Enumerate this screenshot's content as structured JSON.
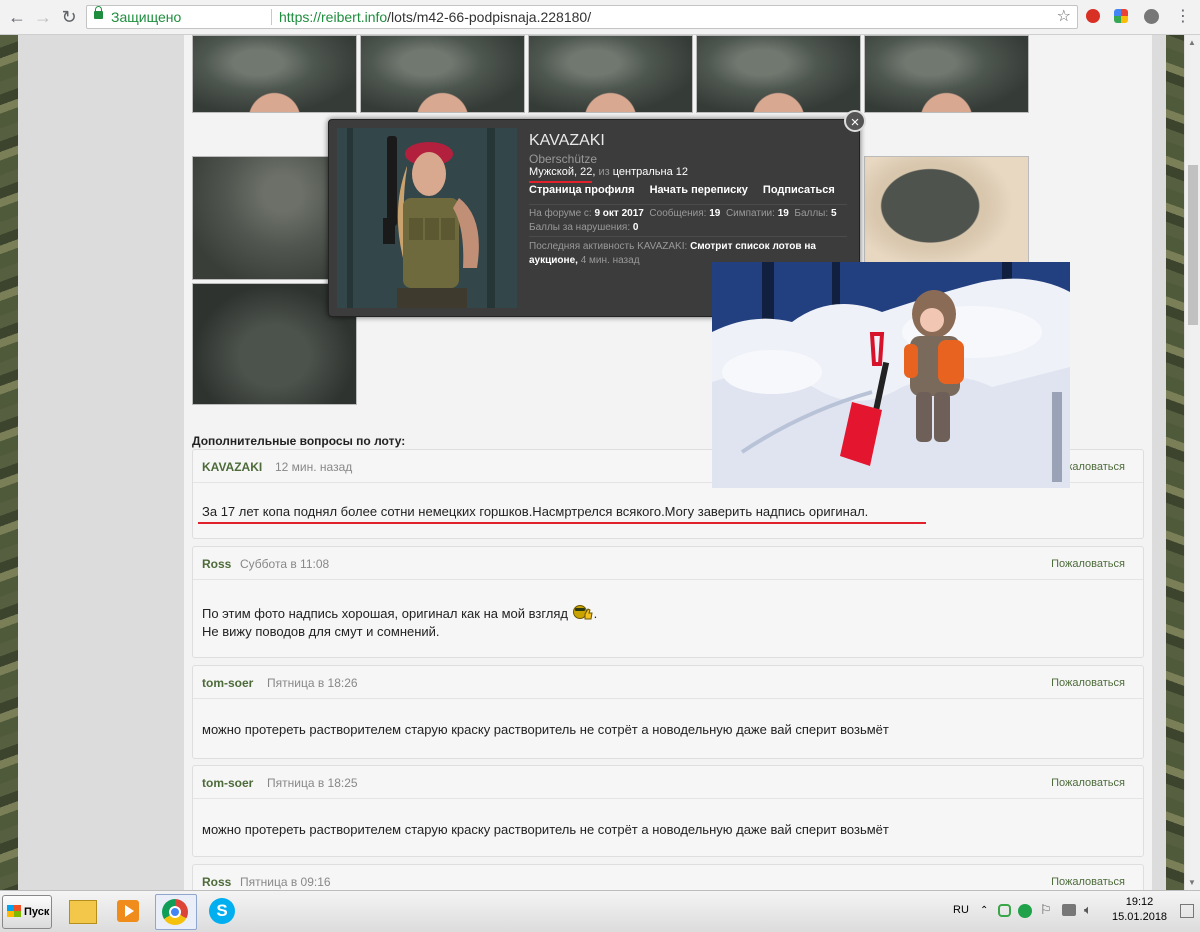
{
  "browser": {
    "secure_label": "Защищено",
    "url_host": "https://reibert.info",
    "url_path": "/lots/m42-66-podpisnaja.228180/"
  },
  "section": {
    "title": "Дополнительные вопросы по лоту:"
  },
  "popup": {
    "name": "KAVAZAKI",
    "rank": "Oberschütze",
    "gender_age": "Мужской, 22,",
    "from_label": "из",
    "location": "центральна 12",
    "links": [
      "Страница профиля",
      "Начать переписку",
      "Подписаться"
    ],
    "stats": {
      "joined_label": "На форуме с:",
      "joined": "9 окт 2017",
      "messages_label": "Сообщения:",
      "messages": "19",
      "likes_label": "Симпатии:",
      "likes": "19",
      "points_label": "Баллы:",
      "points": "5",
      "violations_label": "Баллы за нарушения:",
      "violations": "0"
    },
    "activity_label": "Последняя активность KAVAZAKI:",
    "activity": "Смотрит список лотов на аукционе,",
    "activity_time": "4 мин. назад",
    "close_glyph": "×"
  },
  "posts": [
    {
      "author": "KAVAZAKI",
      "time": "12 мин. назад",
      "report": "Пожаловаться",
      "lines": [
        "За 17 лет копа поднял более сотни немецких горшков.Насмртрелся всякого.Могу заверить надпись оригинал."
      ]
    },
    {
      "author": "Ross",
      "time": "Суббота в 11:08",
      "report": "Пожаловаться",
      "lines": [
        "По этим фото надпись хорошая, оригинал как на мой взгляд",
        "Не вижу поводов для смут и сомнений."
      ],
      "line1_suffix": "."
    },
    {
      "author": "tom-soer",
      "time": "Пятница в 18:26",
      "report": "Пожаловаться",
      "lines": [
        "можно протереть растворителем старую краску растворитель не сотрёт а новодельную даже вай сперит возьмёт"
      ]
    },
    {
      "author": "tom-soer",
      "time": "Пятница в 18:25",
      "report": "Пожаловаться",
      "lines": [
        "можно протереть растворителем старую краску растворитель не сотрёт а новодельную даже вай сперит возьмёт"
      ]
    },
    {
      "author": "Ross",
      "time": "Пятница в 09:16",
      "report": "Пожаловаться",
      "lines": [
        ""
      ]
    }
  ],
  "taskbar": {
    "start_label": "Пуск",
    "lang": "RU",
    "time": "19:12",
    "date": "15.01.2018"
  },
  "colors": {
    "accent_green": "#4d6b3a",
    "underline_red": "#e0202a",
    "popup_bg": "#3c3c3c"
  }
}
